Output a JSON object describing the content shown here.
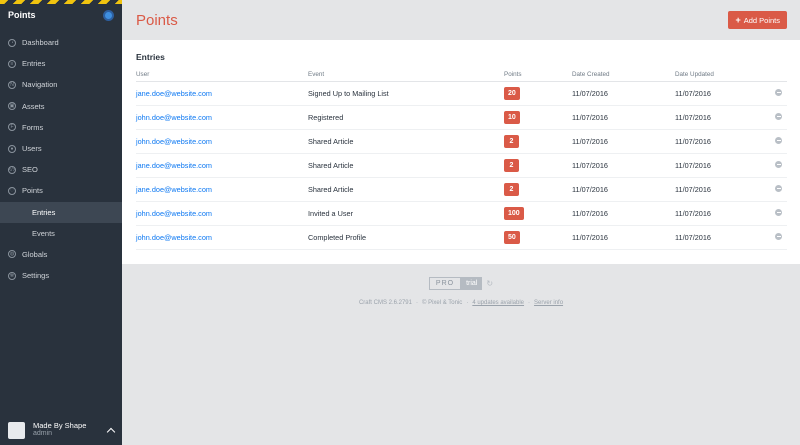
{
  "sidebar": {
    "site_name": "Points",
    "items": [
      {
        "label": "Dashboard",
        "icon": "dashboard-icon",
        "glyph": "◔"
      },
      {
        "label": "Entries",
        "icon": "entries-icon",
        "glyph": "≡"
      },
      {
        "label": "Navigation",
        "icon": "navigation-icon",
        "glyph": "N"
      },
      {
        "label": "Assets",
        "icon": "assets-icon",
        "glyph": "▣"
      },
      {
        "label": "Forms",
        "icon": "forms-icon",
        "glyph": "F"
      },
      {
        "label": "Users",
        "icon": "users-icon",
        "glyph": "●"
      },
      {
        "label": "SEO",
        "icon": "seo-icon",
        "glyph": "</>"
      },
      {
        "label": "Points",
        "icon": "points-icon",
        "glyph": "♡"
      },
      {
        "label": "Entries",
        "sub": true,
        "active": true
      },
      {
        "label": "Events",
        "sub": true
      },
      {
        "label": "Globals",
        "icon": "globals-icon",
        "glyph": "◍"
      },
      {
        "label": "Settings",
        "icon": "settings-icon",
        "glyph": "✻"
      }
    ],
    "user": {
      "name": "Made By Shape",
      "role": "admin"
    }
  },
  "header": {
    "title": "Points",
    "add_label": "Add Points"
  },
  "entries": {
    "title": "Entries",
    "columns": [
      "User",
      "Event",
      "Points",
      "Date Created",
      "Date Updated"
    ],
    "rows": [
      {
        "user": "jane.doe@website.com",
        "event": "Signed Up to Mailing List",
        "points": "20",
        "created": "11/07/2016",
        "updated": "11/07/2016"
      },
      {
        "user": "john.doe@website.com",
        "event": "Registered",
        "points": "10",
        "created": "11/07/2016",
        "updated": "11/07/2016"
      },
      {
        "user": "john.doe@website.com",
        "event": "Shared Article",
        "points": "2",
        "created": "11/07/2016",
        "updated": "11/07/2016"
      },
      {
        "user": "jane.doe@website.com",
        "event": "Shared Article",
        "points": "2",
        "created": "11/07/2016",
        "updated": "11/07/2016"
      },
      {
        "user": "jane.doe@website.com",
        "event": "Shared Article",
        "points": "2",
        "created": "11/07/2016",
        "updated": "11/07/2016"
      },
      {
        "user": "john.doe@website.com",
        "event": "Invited a User",
        "points": "100",
        "created": "11/07/2016",
        "updated": "11/07/2016"
      },
      {
        "user": "john.doe@website.com",
        "event": "Completed Profile",
        "points": "50",
        "created": "11/07/2016",
        "updated": "11/07/2016"
      }
    ]
  },
  "footer": {
    "edition": "PRO",
    "trial": "trial",
    "version": "Craft CMS 2.6.2791",
    "copyright": "© Pixel & Tonic",
    "updates": "4 updates available",
    "server_info": "Server info"
  },
  "colors": {
    "accent": "#da5a47",
    "link": "#0d78f2",
    "sidebar_bg": "#29323d"
  }
}
